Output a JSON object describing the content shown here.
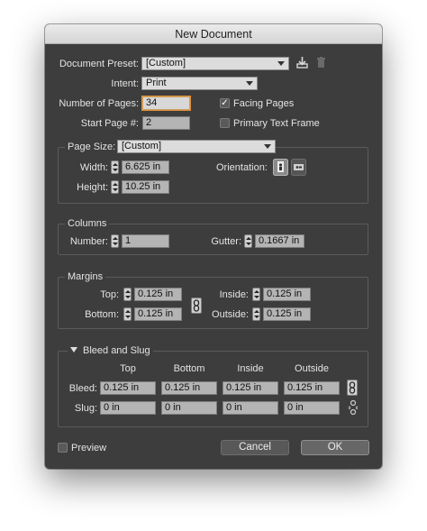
{
  "window": {
    "title": "New Document"
  },
  "document_preset": {
    "label": "Document Preset:",
    "value": "[Custom]"
  },
  "icons": {
    "save_preset": "download-icon",
    "delete_preset": "trash-icon",
    "portrait": "portrait-orientation-icon",
    "landscape": "landscape-orientation-icon",
    "margins_link": "chain-link-icon",
    "bleed_link": "chain-link-icon",
    "slug_link": "broken-chain-icon",
    "disclosure": "triangle-down-icon"
  },
  "intent": {
    "label": "Intent:",
    "value": "Print"
  },
  "number_of_pages": {
    "label": "Number of Pages:",
    "value": "34"
  },
  "start_page": {
    "label": "Start Page #:",
    "value": "2"
  },
  "facing_pages": {
    "label": "Facing Pages",
    "checked": true,
    "mark": "✓"
  },
  "primary_text_frame": {
    "label": "Primary Text Frame",
    "checked": false
  },
  "page_size": {
    "label": "Page Size:",
    "value": "[Custom]",
    "width_label": "Width:",
    "width": "6.625 in",
    "height_label": "Height:",
    "height": "10.25 in",
    "orientation_label": "Orientation:"
  },
  "columns": {
    "legend": "Columns",
    "number_label": "Number:",
    "number": "1",
    "gutter_label": "Gutter:",
    "gutter": "0.1667 in"
  },
  "margins": {
    "legend": "Margins",
    "top_label": "Top:",
    "top": "0.125 in",
    "bottom_label": "Bottom:",
    "bottom": "0.125 in",
    "inside_label": "Inside:",
    "inside": "0.125 in",
    "outside_label": "Outside:",
    "outside": "0.125 in"
  },
  "bleed_slug": {
    "legend": "Bleed and Slug",
    "headers": [
      "Top",
      "Bottom",
      "Inside",
      "Outside"
    ],
    "bleed_label": "Bleed:",
    "bleed": [
      "0.125 in",
      "0.125 in",
      "0.125 in",
      "0.125 in"
    ],
    "slug_label": "Slug:",
    "slug": [
      "0 in",
      "0 in",
      "0 in",
      "0 in"
    ]
  },
  "preview": {
    "label": "Preview",
    "checked": false
  },
  "buttons": {
    "cancel": "Cancel",
    "ok": "OK"
  }
}
